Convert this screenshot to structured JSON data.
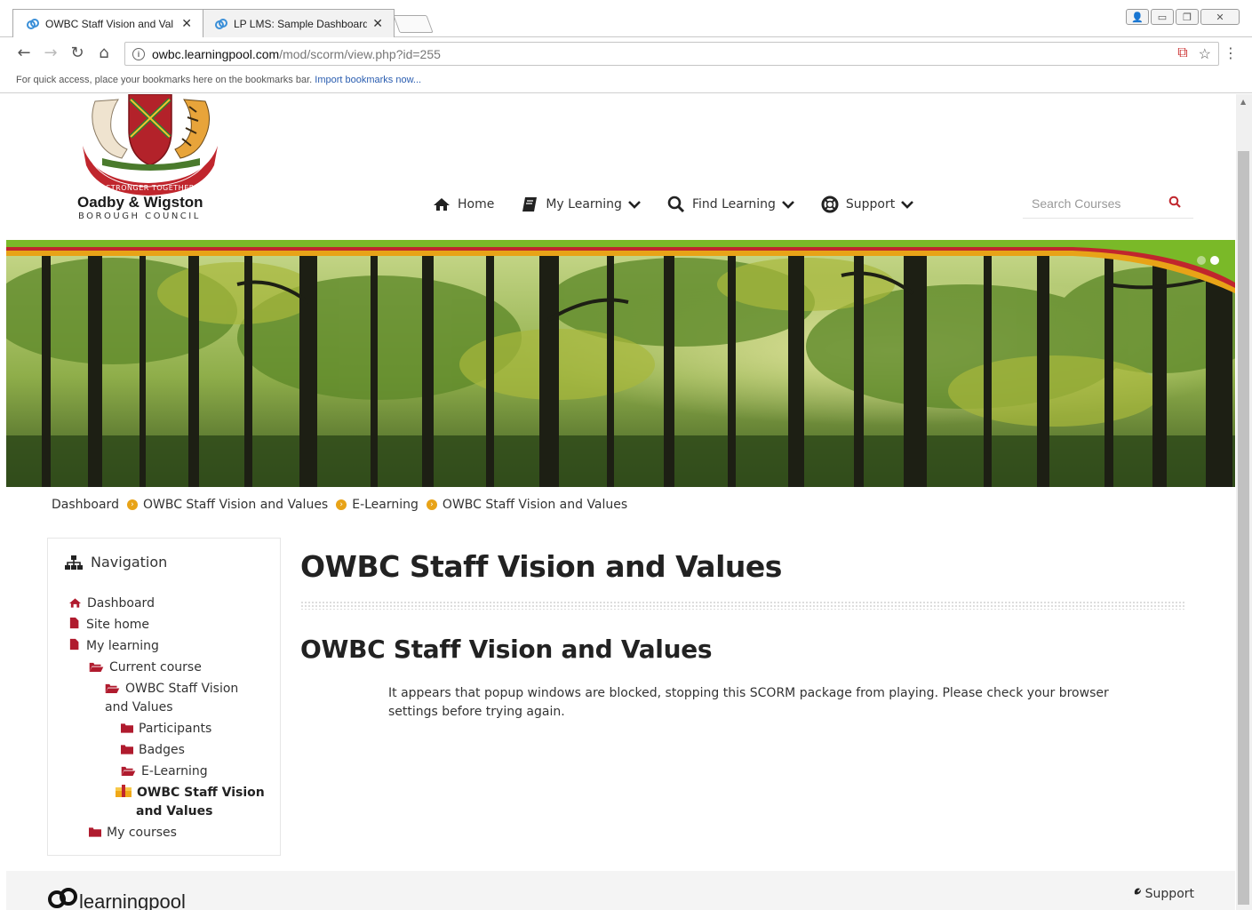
{
  "browser": {
    "tabs": [
      {
        "title": "OWBC Staff Vision and Val",
        "active": true
      },
      {
        "title": "LP LMS: Sample Dashboard",
        "active": false
      }
    ],
    "url_host": "owbc.learningpool.com",
    "url_path": "/mod/scorm/view.php?id=255",
    "bookmark_hint": "For quick access, place your bookmarks here on the bookmarks bar.",
    "bookmark_link": "Import bookmarks now..."
  },
  "site": {
    "brand_name": "Oadby & Wigston",
    "brand_sub": "BOROUGH COUNCIL",
    "logo_motto": "STRONGER TOGETHER"
  },
  "mainnav": {
    "home": "Home",
    "my_learning": "My Learning",
    "find_learning": "Find Learning",
    "support": "Support"
  },
  "search": {
    "placeholder": "Search Courses"
  },
  "breadcrumb": [
    "Dashboard",
    "OWBC Staff Vision and Values",
    "E-Learning",
    "OWBC Staff Vision and Values"
  ],
  "navigation": {
    "title": "Navigation",
    "items": {
      "dashboard": "Dashboard",
      "site_home": "Site home",
      "my_learning": "My learning",
      "current_course": "Current course",
      "course_line1": "OWBC Staff Vision",
      "course_line2": "and Values",
      "participants": "Participants",
      "badges": "Badges",
      "elearning": "E-Learning",
      "activity_line1": "OWBC Staff Vision",
      "activity_line2": "and Values",
      "my_courses": "My courses"
    }
  },
  "main": {
    "page_title": "OWBC Staff Vision and Values",
    "section_title": "OWBC Staff Vision and Values",
    "message_line1": "It appears that popup windows are blocked, stopping this SCORM package from playing. Please check your browser",
    "message_line2": "settings before trying again."
  },
  "footer": {
    "brand": "learningpool",
    "support": "Support"
  },
  "colors": {
    "accent_orange": "#e8a317",
    "folder_red": "#b01b2e",
    "banner_green": "#7ab928",
    "banner_red": "#c0262d"
  },
  "icons": [
    "home-icon",
    "book-icon",
    "search-icon",
    "lifebuoy-icon",
    "sitemap-icon",
    "file-icon",
    "folder-icon",
    "folder-open-icon",
    "scorm-package-icon",
    "wrench-icon"
  ]
}
